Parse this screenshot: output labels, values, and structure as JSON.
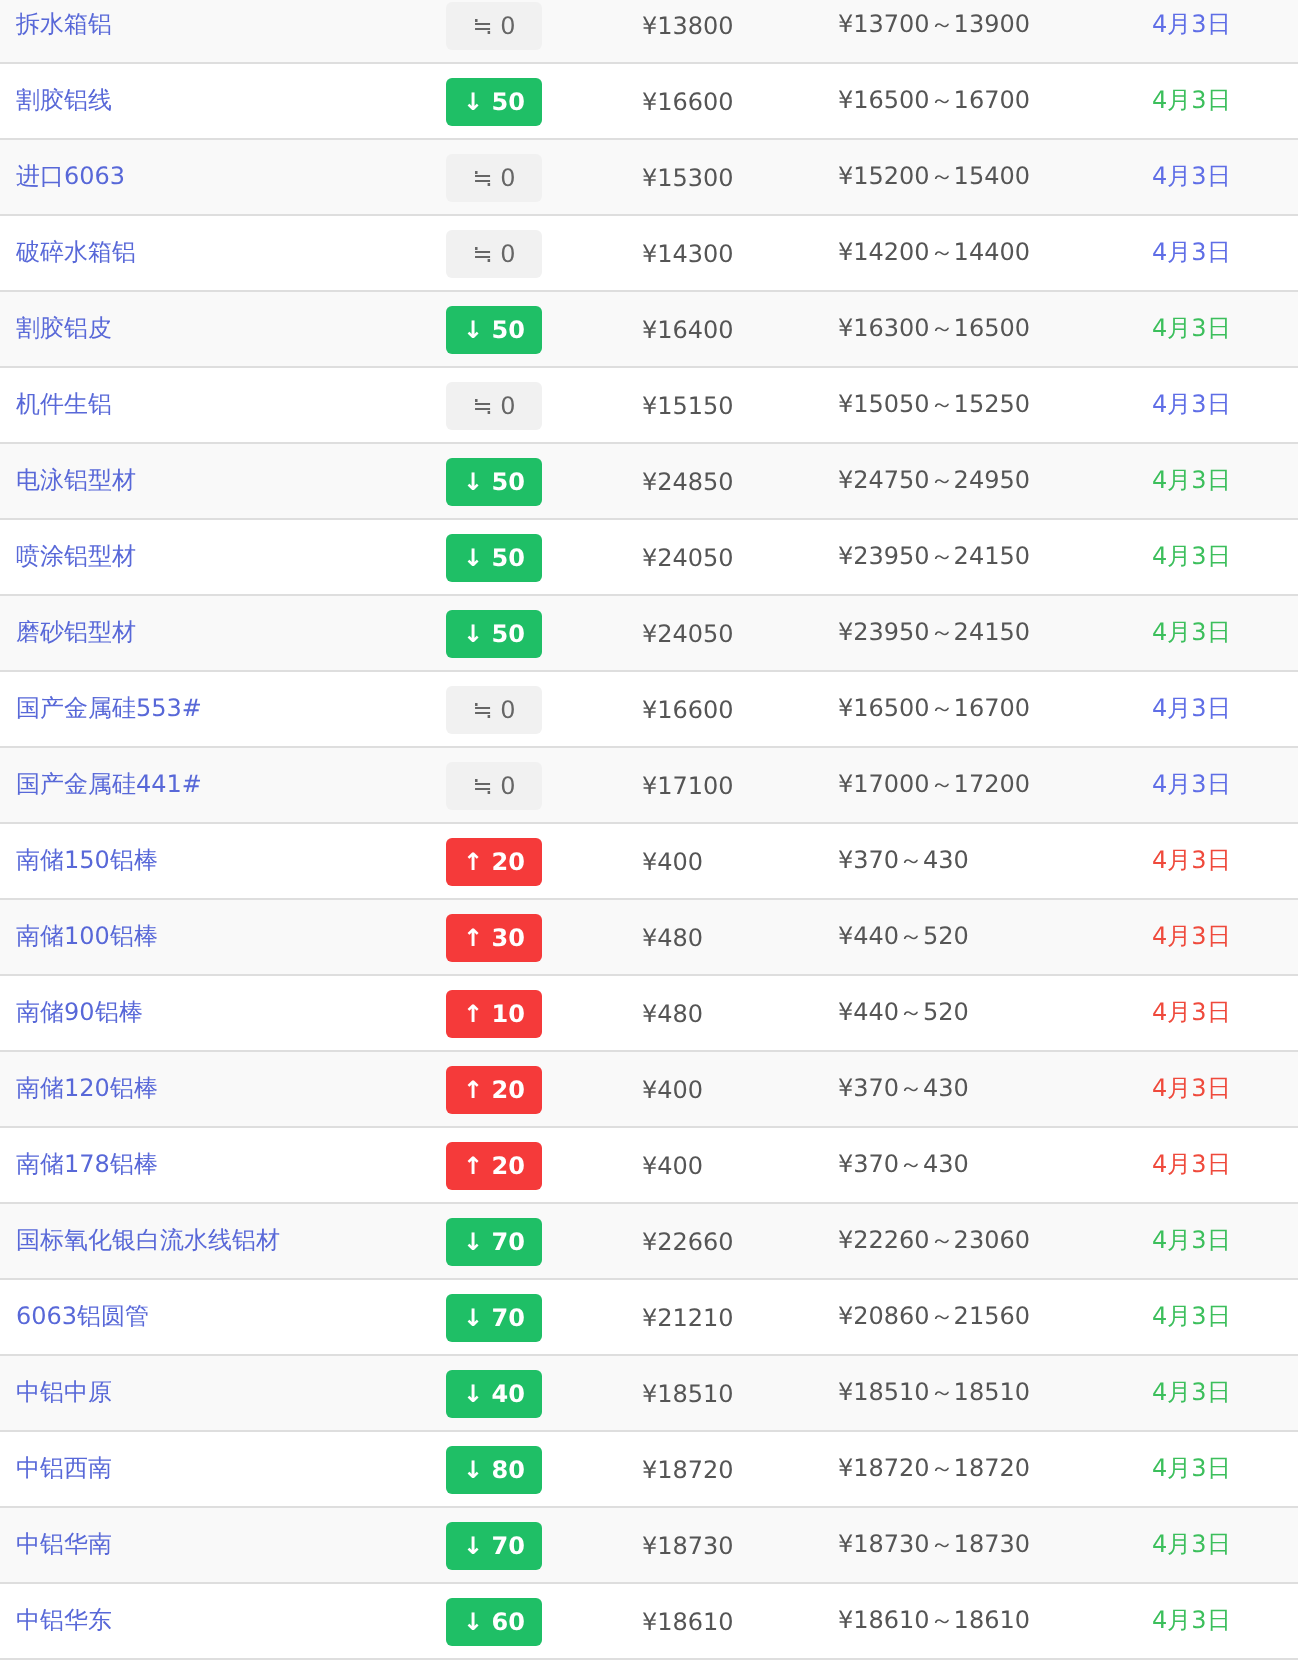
{
  "rows": [
    {
      "name": "拆水箱铝",
      "kind": "flat",
      "change": "≒ 0",
      "price": "¥13800",
      "range": "¥13700～13900",
      "date": "4月3日"
    },
    {
      "name": "割胶铝线",
      "kind": "down",
      "change": "↓ 50",
      "price": "¥16600",
      "range": "¥16500～16700",
      "date": "4月3日"
    },
    {
      "name": "进口6063",
      "kind": "flat",
      "change": "≒ 0",
      "price": "¥15300",
      "range": "¥15200～15400",
      "date": "4月3日"
    },
    {
      "name": "破碎水箱铝",
      "kind": "flat",
      "change": "≒ 0",
      "price": "¥14300",
      "range": "¥14200～14400",
      "date": "4月3日"
    },
    {
      "name": "割胶铝皮",
      "kind": "down",
      "change": "↓ 50",
      "price": "¥16400",
      "range": "¥16300～16500",
      "date": "4月3日"
    },
    {
      "name": "机件生铝",
      "kind": "flat",
      "change": "≒ 0",
      "price": "¥15150",
      "range": "¥15050～15250",
      "date": "4月3日"
    },
    {
      "name": "电泳铝型材",
      "kind": "down",
      "change": "↓ 50",
      "price": "¥24850",
      "range": "¥24750～24950",
      "date": "4月3日"
    },
    {
      "name": "喷涂铝型材",
      "kind": "down",
      "change": "↓ 50",
      "price": "¥24050",
      "range": "¥23950～24150",
      "date": "4月3日"
    },
    {
      "name": "磨砂铝型材",
      "kind": "down",
      "change": "↓ 50",
      "price": "¥24050",
      "range": "¥23950～24150",
      "date": "4月3日"
    },
    {
      "name": "国产金属硅553#",
      "kind": "flat",
      "change": "≒ 0",
      "price": "¥16600",
      "range": "¥16500～16700",
      "date": "4月3日"
    },
    {
      "name": "国产金属硅441#",
      "kind": "flat",
      "change": "≒ 0",
      "price": "¥17100",
      "range": "¥17000～17200",
      "date": "4月3日"
    },
    {
      "name": "南储150铝棒",
      "kind": "up",
      "change": "↑ 20",
      "price": "¥400",
      "range": "¥370～430",
      "date": "4月3日"
    },
    {
      "name": "南储100铝棒",
      "kind": "up",
      "change": "↑ 30",
      "price": "¥480",
      "range": "¥440～520",
      "date": "4月3日"
    },
    {
      "name": "南储90铝棒",
      "kind": "up",
      "change": "↑ 10",
      "price": "¥480",
      "range": "¥440～520",
      "date": "4月3日"
    },
    {
      "name": "南储120铝棒",
      "kind": "up",
      "change": "↑ 20",
      "price": "¥400",
      "range": "¥370～430",
      "date": "4月3日"
    },
    {
      "name": "南储178铝棒",
      "kind": "up",
      "change": "↑ 20",
      "price": "¥400",
      "range": "¥370～430",
      "date": "4月3日"
    },
    {
      "name": "国标氧化银白流水线铝材",
      "kind": "down",
      "change": "↓ 70",
      "price": "¥22660",
      "range": "¥22260～23060",
      "date": "4月3日"
    },
    {
      "name": "6063铝圆管",
      "kind": "down",
      "change": "↓ 70",
      "price": "¥21210",
      "range": "¥20860～21560",
      "date": "4月3日"
    },
    {
      "name": "中铝中原",
      "kind": "down",
      "change": "↓ 40",
      "price": "¥18510",
      "range": "¥18510～18510",
      "date": "4月3日"
    },
    {
      "name": "中铝西南",
      "kind": "down",
      "change": "↓ 80",
      "price": "¥18720",
      "range": "¥18720～18720",
      "date": "4月3日"
    },
    {
      "name": "中铝华南",
      "kind": "down",
      "change": "↓ 70",
      "price": "¥18730",
      "range": "¥18730～18730",
      "date": "4月3日"
    },
    {
      "name": "中铝华东",
      "kind": "down",
      "change": "↓ 60",
      "price": "¥18610",
      "range": "¥18610～18610",
      "date": "4月3日"
    }
  ]
}
